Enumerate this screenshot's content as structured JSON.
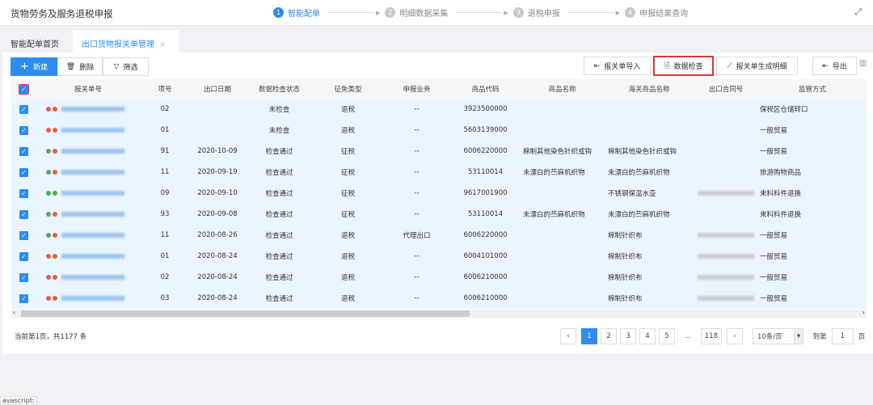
{
  "header": {
    "title": "货物劳务及服务退税申报",
    "fullscreen_icon": "expand-icon",
    "steps": [
      {
        "num": "1",
        "label": "智能配单",
        "active": true
      },
      {
        "num": "2",
        "label": "明细数据采集"
      },
      {
        "num": "3",
        "label": "退税申报"
      },
      {
        "num": "4",
        "label": "申报结果查询"
      }
    ]
  },
  "tabs": [
    {
      "label": "智能配单首页"
    },
    {
      "label": "出口货物报关单管理",
      "active": true,
      "close": "×"
    }
  ],
  "toolbar": {
    "new": "新建",
    "delete": "删除",
    "filter": "筛选",
    "import": "报关单导入",
    "check": "数据检查",
    "generate": "报关单生成明细",
    "export": "导出"
  },
  "columns": [
    "报关单号",
    "项号",
    "出口日期",
    "数据检查状态",
    "征免类型",
    "申报业务",
    "商品代码",
    "商品名称",
    "海关商品名称",
    "出口合同号",
    "监管方式"
  ],
  "colors": {
    "accent": "#2d8cf0",
    "dot_green": "#4caf50",
    "dot_red": "#e8603c",
    "highlight": "#d9383a",
    "row_bg": "#ebf5fe"
  },
  "rows": [
    {
      "dots": [
        "red",
        "red"
      ],
      "item": "02",
      "date": "",
      "status": "未检查",
      "tax": "退税",
      "biz": "--",
      "code": "3923500000",
      "name": "",
      "customs_name": "",
      "contract": false,
      "mode": "保税区仓储转口"
    },
    {
      "dots": [
        "red",
        "red"
      ],
      "item": "01",
      "date": "",
      "status": "未检查",
      "tax": "退税",
      "biz": "--",
      "code": "5603139000",
      "name": "",
      "customs_name": "",
      "contract": false,
      "mode": "一般贸易"
    },
    {
      "dots": [
        "green",
        "red"
      ],
      "item": "91",
      "date": "2020-10-09",
      "status": "检查通过",
      "tax": "征税",
      "biz": "--",
      "code": "6006220000",
      "name": "棉制其他染色针织或钩",
      "customs_name": "棉制其他染色针织或钩",
      "contract": false,
      "mode": "一般贸易"
    },
    {
      "dots": [
        "green",
        "red"
      ],
      "item": "11",
      "date": "2020-09-19",
      "status": "检查通过",
      "tax": "征税",
      "biz": "--",
      "code": "53110014",
      "name": "未漂白的苎麻机织物",
      "customs_name": "未漂白的苎麻机织物",
      "contract": false,
      "mode": "旅游购物商品"
    },
    {
      "dots": [
        "green",
        "green"
      ],
      "item": "09",
      "date": "2020-09-10",
      "status": "检查通过",
      "tax": "征税",
      "biz": "--",
      "code": "9617001900",
      "name": "",
      "customs_name": "不锈钢保温水壶",
      "contract": true,
      "mode": "来料料件退换"
    },
    {
      "dots": [
        "green",
        "red"
      ],
      "item": "93",
      "date": "2020-09-08",
      "status": "检查通过",
      "tax": "征税",
      "biz": "--",
      "code": "53110014",
      "name": "未漂白的苎麻机织物",
      "customs_name": "未漂白的苎麻机织物",
      "contract": false,
      "mode": "来料料件退换"
    },
    {
      "dots": [
        "green",
        "red"
      ],
      "item": "11",
      "date": "2020-08-26",
      "status": "检查通过",
      "tax": "退税",
      "biz": "代理出口",
      "code": "6006220000",
      "name": "",
      "customs_name": "棉制针织布",
      "contract": true,
      "mode": "一般贸易"
    },
    {
      "dots": [
        "red",
        "red"
      ],
      "item": "01",
      "date": "2020-08-24",
      "status": "检查通过",
      "tax": "退税",
      "biz": "--",
      "code": "6004101000",
      "name": "",
      "customs_name": "棉制针织布",
      "contract": true,
      "mode": "一般贸易"
    },
    {
      "dots": [
        "red",
        "red"
      ],
      "item": "02",
      "date": "2020-08-24",
      "status": "检查通过",
      "tax": "退税",
      "biz": "--",
      "code": "6006210000",
      "name": "",
      "customs_name": "棉制针织布",
      "contract": true,
      "mode": "一般贸易"
    },
    {
      "dots": [
        "red",
        "red"
      ],
      "item": "03",
      "date": "2020-08-24",
      "status": "检查通过",
      "tax": "退税",
      "biz": "--",
      "code": "6006210000",
      "name": "",
      "customs_name": "棉制针织布",
      "contract": true,
      "mode": "一般贸易"
    }
  ],
  "footer": {
    "summary": "当前第1页，共1177 条",
    "pages": [
      "1",
      "2",
      "3",
      "4",
      "5",
      "...",
      "118"
    ],
    "current_page": "1",
    "page_size": "10条/页",
    "goto_label": "到第",
    "goto_value": "1",
    "page_unit": "页"
  },
  "status_bar": "avascript:"
}
